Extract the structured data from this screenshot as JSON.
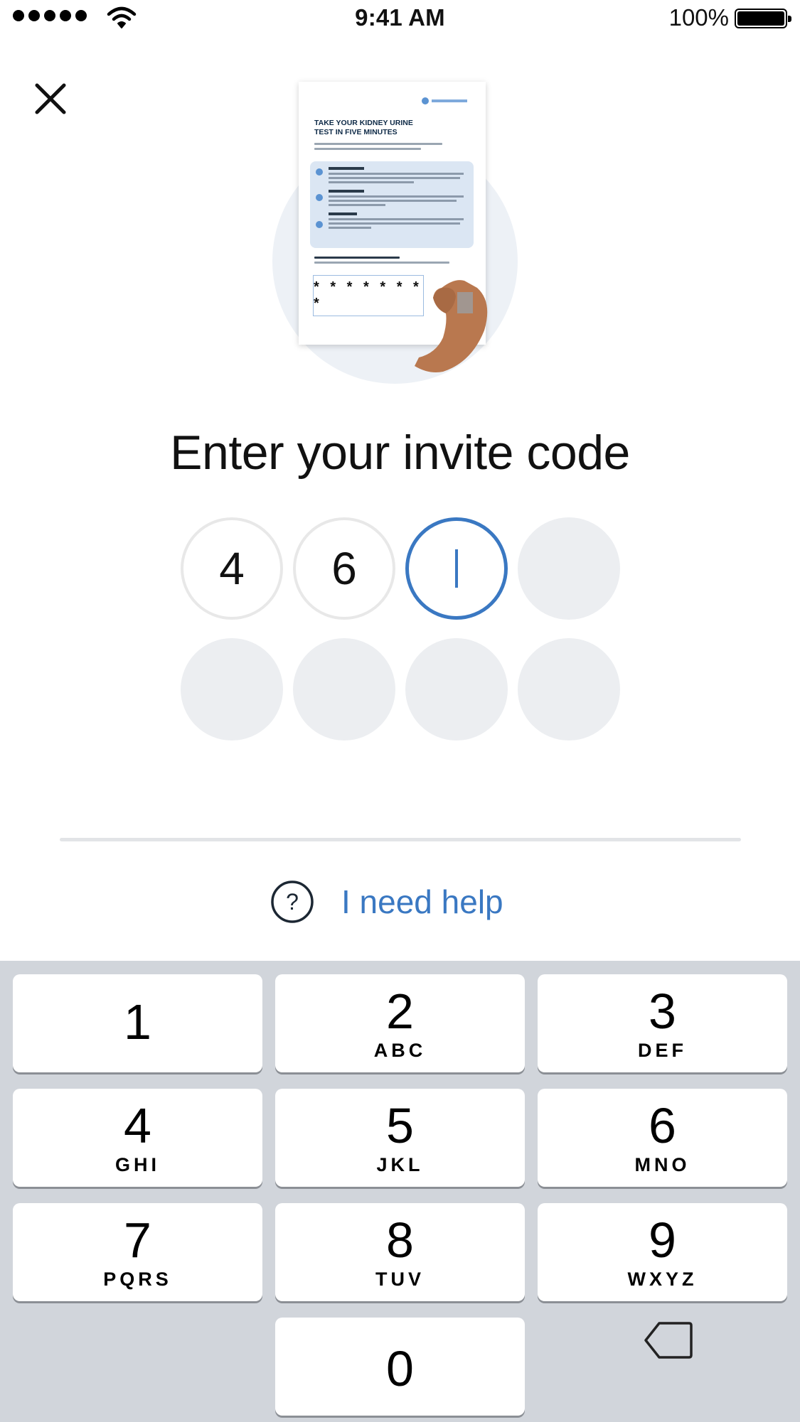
{
  "status_bar": {
    "time": "9:41 AM",
    "battery_percent": "100%",
    "battery_level": 1.0
  },
  "colors": {
    "accent": "#3a78c2",
    "keypad_bg": "#d1d5db",
    "empty_digit": "#eceef1"
  },
  "icons": {
    "close": "close-icon",
    "help": "question-circle-icon",
    "backspace": "backspace-icon"
  },
  "illustration": {
    "card_title": "TAKE YOUR KIDNEY URINE TEST IN FIVE MINUTES",
    "code_mask": "* * * * * * * *"
  },
  "title": "Enter your invite code",
  "code_digits": [
    "4",
    "6",
    "",
    "",
    "",
    "",
    "",
    ""
  ],
  "active_digit_index": 2,
  "help_label": "I need help",
  "keypad": [
    {
      "num": "1",
      "letters": ""
    },
    {
      "num": "2",
      "letters": "ABC"
    },
    {
      "num": "3",
      "letters": "DEF"
    },
    {
      "num": "4",
      "letters": "GHI"
    },
    {
      "num": "5",
      "letters": "JKL"
    },
    {
      "num": "6",
      "letters": "MNO"
    },
    {
      "num": "7",
      "letters": "PQRS"
    },
    {
      "num": "8",
      "letters": "TUV"
    },
    {
      "num": "9",
      "letters": "WXYZ"
    },
    {
      "num": "0",
      "letters": ""
    }
  ]
}
